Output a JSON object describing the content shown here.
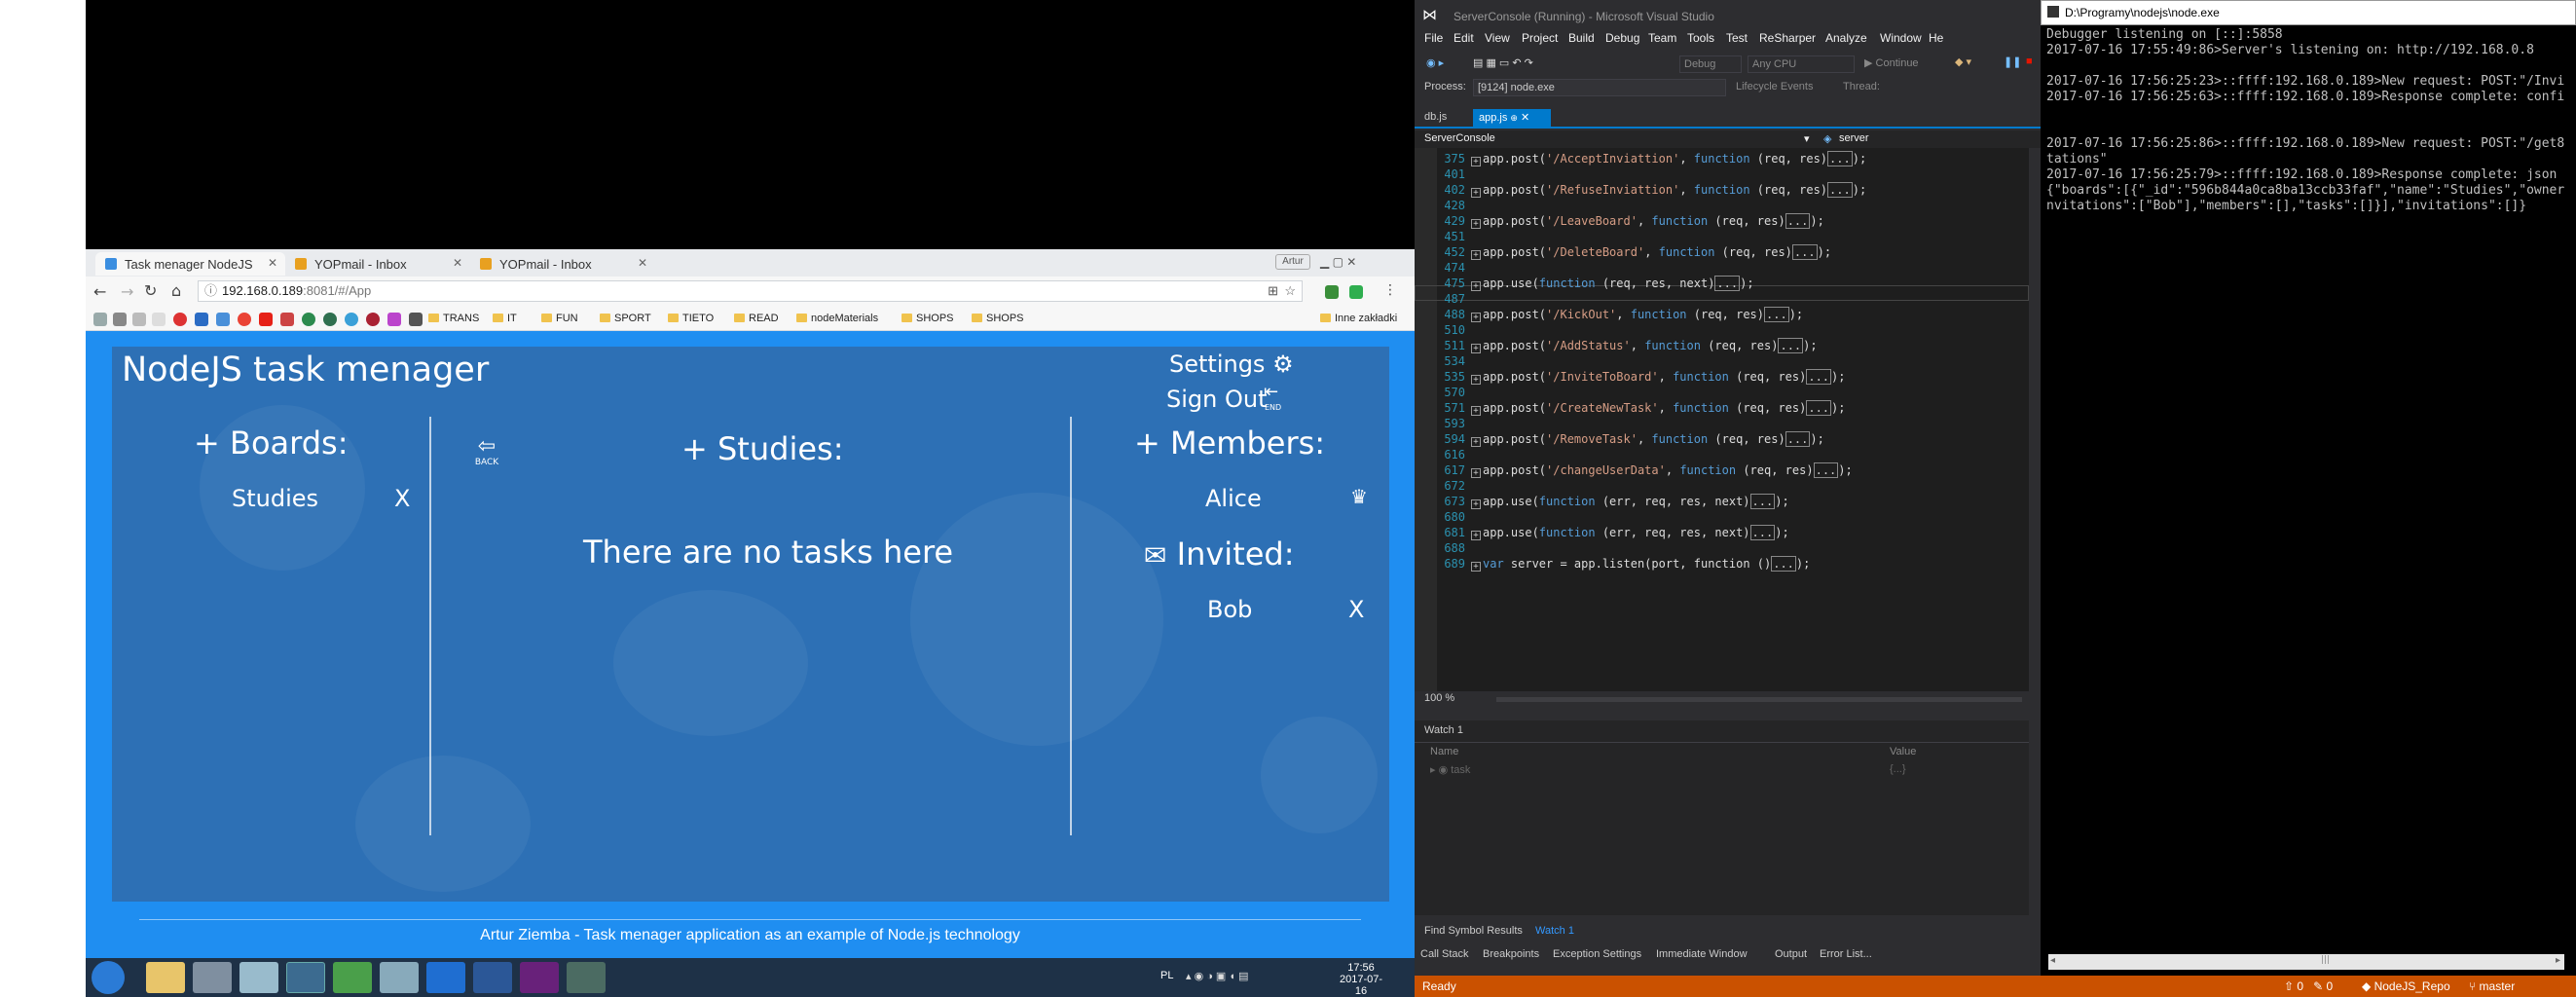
{
  "browser": {
    "tabs": [
      {
        "label": "Task menager NodeJS",
        "active": true
      },
      {
        "label": "YOPmail - Inbox",
        "active": false
      },
      {
        "label": "YOPmail - Inbox",
        "active": false
      }
    ],
    "user_badge": "Artur",
    "url_host": "192.168.0.189",
    "url_path": ":8081/#/App",
    "bookmarks": [
      "TRANS",
      "IT",
      "FUN",
      "SPORT",
      "TIETO",
      "READ",
      "nodeMaterials",
      "SHOPS",
      "SHOPS"
    ],
    "bookmarks_other": "Inne zakładki",
    "colors": {
      "app_bg": "#1f8ef1",
      "panel": "#2d70b5"
    }
  },
  "app": {
    "title": "NodeJS task menager",
    "settings_label": "Settings",
    "sign_out_label": "Sign Out",
    "end_label": "END",
    "back_label": "BACK",
    "boards_header": "+ Boards:",
    "board_item": "Studies",
    "board_remove": "X",
    "tasks_header": "+ Studies:",
    "empty_message": "There are no tasks here",
    "members_header": "+ Members:",
    "member": "Alice",
    "invited_header": "Invited:",
    "invited_member": "Bob",
    "invited_remove": "X",
    "footer": "Artur Ziemba - Task menager application as an example of Node.js technology"
  },
  "taskbar": {
    "lang": "PL",
    "time": "17:56",
    "date": "2017-07-16"
  },
  "vs": {
    "title": "ServerConsole (Running) - Microsoft Visual Studio",
    "menu": [
      "File",
      "Edit",
      "View",
      "Project",
      "Build",
      "Debug",
      "Team",
      "Tools",
      "Test",
      "ReSharper",
      "Analyze",
      "Window",
      "He"
    ],
    "toolbar_config": "Debug",
    "toolbar_platform": "Any CPU",
    "toolbar_continue": "Continue",
    "process_label": "Process:",
    "process_value": "[9124] node.exe",
    "lifecycle_label": "Lifecycle Events",
    "thread_label": "Thread:",
    "file_tabs": [
      "db.js",
      "app.js"
    ],
    "nav_left": "ServerConsole",
    "nav_right": "server",
    "code_lines": [
      {
        "n": "375",
        "pre": "app.post(",
        "str": "'/AcceptInviattion'",
        "post": ", ",
        "kw": "function",
        "args": " (req, res)"
      },
      {
        "n": "401",
        "pre": "",
        "str": "",
        "post": "",
        "kw": "",
        "args": ""
      },
      {
        "n": "402",
        "pre": "app.post(",
        "str": "'/RefuseInviattion'",
        "post": ", ",
        "kw": "function",
        "args": " (req, res)"
      },
      {
        "n": "428",
        "pre": "",
        "str": "",
        "post": "",
        "kw": "",
        "args": ""
      },
      {
        "n": "429",
        "pre": "app.post(",
        "str": "'/LeaveBoard'",
        "post": ", ",
        "kw": "function",
        "args": " (req, res)"
      },
      {
        "n": "451",
        "pre": "",
        "str": "",
        "post": "",
        "kw": "",
        "args": ""
      },
      {
        "n": "452",
        "pre": "app.post(",
        "str": "'/DeleteBoard'",
        "post": ", ",
        "kw": "function",
        "args": " (req, res)"
      },
      {
        "n": "474",
        "pre": "",
        "str": "",
        "post": "",
        "kw": "",
        "args": ""
      },
      {
        "n": "475",
        "pre": "app.use(",
        "str": "",
        "post": "",
        "kw": "function",
        "args": " (req, res, next)"
      },
      {
        "n": "487",
        "pre": "",
        "str": "",
        "post": "",
        "kw": "",
        "args": ""
      },
      {
        "n": "488",
        "pre": "app.post(",
        "str": "'/KickOut'",
        "post": ", ",
        "kw": "function",
        "args": " (req, res)"
      },
      {
        "n": "510",
        "pre": "",
        "str": "",
        "post": "",
        "kw": "",
        "args": ""
      },
      {
        "n": "511",
        "pre": "app.post(",
        "str": "'/AddStatus'",
        "post": ", ",
        "kw": "function",
        "args": " (req, res)"
      },
      {
        "n": "534",
        "pre": "",
        "str": "",
        "post": "",
        "kw": "",
        "args": ""
      },
      {
        "n": "535",
        "pre": "app.post(",
        "str": "'/InviteToBoard'",
        "post": ", ",
        "kw": "function",
        "args": " (req, res)"
      },
      {
        "n": "570",
        "pre": "",
        "str": "",
        "post": "",
        "kw": "",
        "args": ""
      },
      {
        "n": "571",
        "pre": "app.post(",
        "str": "'/CreateNewTask'",
        "post": ", ",
        "kw": "function",
        "args": " (req, res)"
      },
      {
        "n": "593",
        "pre": "",
        "str": "",
        "post": "",
        "kw": "",
        "args": ""
      },
      {
        "n": "594",
        "pre": "app.post(",
        "str": "'/RemoveTask'",
        "post": ", ",
        "kw": "function",
        "args": " (req, res)"
      },
      {
        "n": "616",
        "pre": "",
        "str": "",
        "post": "",
        "kw": "",
        "args": ""
      },
      {
        "n": "617",
        "pre": "app.post(",
        "str": "'/changeUserData'",
        "post": ", ",
        "kw": "function",
        "args": " (req, res)"
      },
      {
        "n": "672",
        "pre": "",
        "str": "",
        "post": "",
        "kw": "",
        "args": ""
      },
      {
        "n": "673",
        "pre": "app.use(",
        "str": "",
        "post": "",
        "kw": "function",
        "args": " (err, req, res, next)"
      },
      {
        "n": "680",
        "pre": "",
        "str": "",
        "post": "",
        "kw": "",
        "args": ""
      },
      {
        "n": "681",
        "pre": "app.use(",
        "str": "",
        "post": "",
        "kw": "function",
        "args": " (err, req, res, next)"
      },
      {
        "n": "688",
        "pre": "",
        "str": "",
        "post": "",
        "kw": "",
        "args": ""
      },
      {
        "n": "689",
        "pre": "",
        "str": "",
        "post": "",
        "kw": "var",
        "args": " server = app.listen(port, function ()"
      }
    ],
    "collapsed_marker": "...",
    "zoom": "100 %",
    "watch_title": "Watch 1",
    "watch_col_name": "Name",
    "watch_col_value": "Value",
    "watch_row_name": "task",
    "watch_row_value": "{...}",
    "bottom_tabs_1": [
      "Find Symbol Results",
      "Watch 1"
    ],
    "bottom_tabs_2": [
      "Call Stack",
      "Breakpoints",
      "Exception Settings",
      "Immediate Window",
      "Output",
      "Error List..."
    ],
    "status": "Ready"
  },
  "console": {
    "title": "D:\\Programy\\nodejs\\node.exe",
    "lines": [
      "Debugger listening on [::]:5858",
      "2017-07-16 17:55:49:86>Server's listening on: http://192.168.0.8",
      "",
      "2017-07-16 17:56:25:23>::ffff:192.168.0.189>New request: POST:\"/Invi",
      "2017-07-16 17:56:25:63>::ffff:192.168.0.189>Response complete: confi",
      "",
      "",
      "2017-07-16 17:56:25:86>::ffff:192.168.0.189>New request: POST:\"/get8",
      "tations\"",
      "2017-07-16 17:56:25:79>::ffff:192.168.0.189>Response complete: json",
      "{\"boards\":[{\"_id\":\"596b844a0ca8ba13ccb33faf\",\"name\":\"Studies\",\"owner",
      "nvitations\":[\"Bob\"],\"members\":[],\"tasks\":[]}],\"invitations\":[]}"
    ],
    "status_right": "NodeJS_Repo",
    "status_branch": "master"
  }
}
